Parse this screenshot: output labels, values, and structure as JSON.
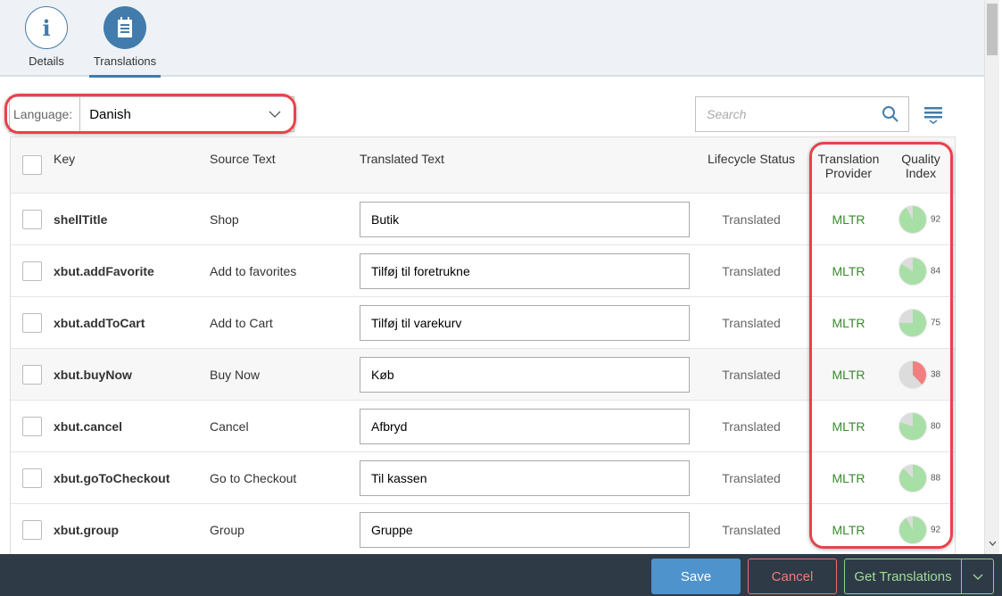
{
  "tabs": [
    {
      "label": "Details",
      "icon": "info-icon",
      "active": false
    },
    {
      "label": "Translations",
      "icon": "notepad-icon",
      "active": true
    }
  ],
  "language": {
    "label": "Language:",
    "value": "Danish"
  },
  "search": {
    "placeholder": "Search"
  },
  "columns": {
    "key": "Key",
    "source": "Source Text",
    "translated": "Translated Text",
    "lifecycle": "Lifecycle Status",
    "provider_1": "Translation",
    "provider_2": "Provider",
    "quality_1": "Quality",
    "quality_2": "Index"
  },
  "rows": [
    {
      "key": "shellTitle",
      "source": "Shop",
      "translated": "Butik",
      "status": "Translated",
      "provider": "MLTR",
      "quality": 92
    },
    {
      "key": "xbut.addFavorite",
      "source": "Add to favorites",
      "translated": "Tilføj til foretrukne",
      "status": "Translated",
      "provider": "MLTR",
      "quality": 84
    },
    {
      "key": "xbut.addToCart",
      "source": "Add to Cart",
      "translated": "Tilføj til varekurv",
      "status": "Translated",
      "provider": "MLTR",
      "quality": 75
    },
    {
      "key": "xbut.buyNow",
      "source": "Buy Now",
      "translated": "Køb",
      "status": "Translated",
      "provider": "MLTR",
      "quality": 38
    },
    {
      "key": "xbut.cancel",
      "source": "Cancel",
      "translated": "Afbryd",
      "status": "Translated",
      "provider": "MLTR",
      "quality": 80
    },
    {
      "key": "xbut.goToCheckout",
      "source": "Go to Checkout",
      "translated": "Til kassen",
      "status": "Translated",
      "provider": "MLTR",
      "quality": 88
    },
    {
      "key": "xbut.group",
      "source": "Group",
      "translated": "Gruppe",
      "status": "Translated",
      "provider": "MLTR",
      "quality": 92
    }
  ],
  "footer": {
    "save": "Save",
    "cancel": "Cancel",
    "get_translations": "Get Translations"
  },
  "colors": {
    "accent": "#427cac",
    "good": "#a8dfa6",
    "bad": "#f08080",
    "highlight": "#e8424a"
  }
}
